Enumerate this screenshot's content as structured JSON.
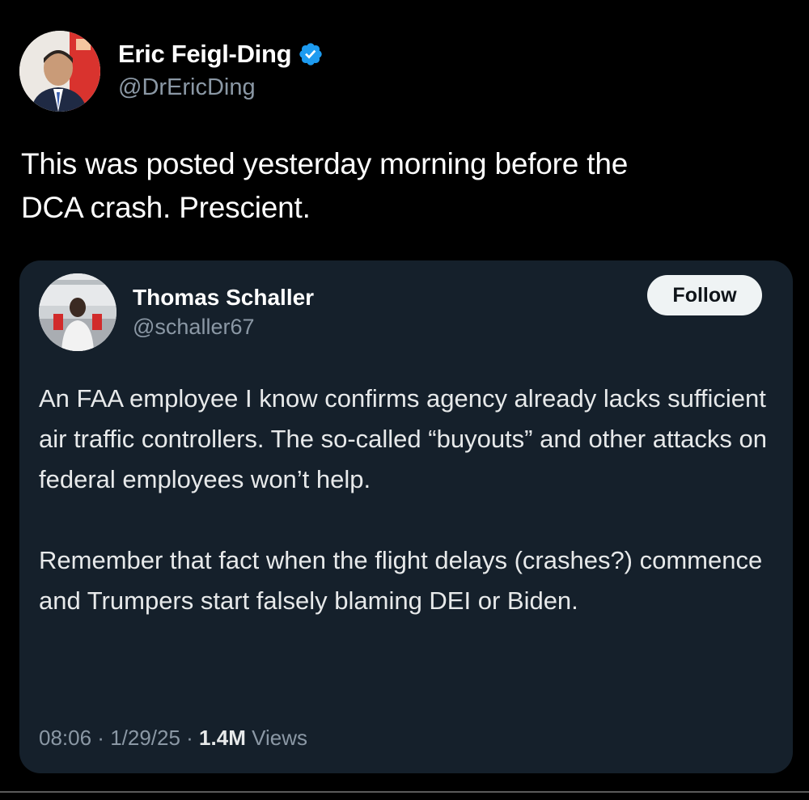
{
  "outer_tweet": {
    "author_name": "Eric Feigl-Ding",
    "author_handle": "@DrEricDing",
    "verified": true,
    "text_lines": [
      "This was posted yesterday morning before the",
      "DCA crash. Prescient."
    ]
  },
  "quoted_tweet": {
    "author_name": "Thomas Schaller",
    "author_handle": "@schaller67",
    "follow_label": "Follow",
    "paragraphs": [
      "An FAA employee I know confirms agency already lacks sufficient air traffic controllers. The so-called “buyouts” and other attacks on federal employees won’t help.",
      "Remember that fact when the flight delays (crashes?) commence and Trumpers start falsely blaming DEI or Biden."
    ],
    "meta": {
      "time": "08:06",
      "separator": " · ",
      "date": "1/29/25",
      "views_count": "1.4M",
      "views_label": " Views"
    }
  },
  "colors": {
    "background": "#000000",
    "card_background": "#15202b",
    "verified_blue": "#1d9bf0",
    "secondary_text": "#8b98a5",
    "primary_text": "#ffffff"
  },
  "icons": {
    "verified": "verified-badge-icon"
  }
}
